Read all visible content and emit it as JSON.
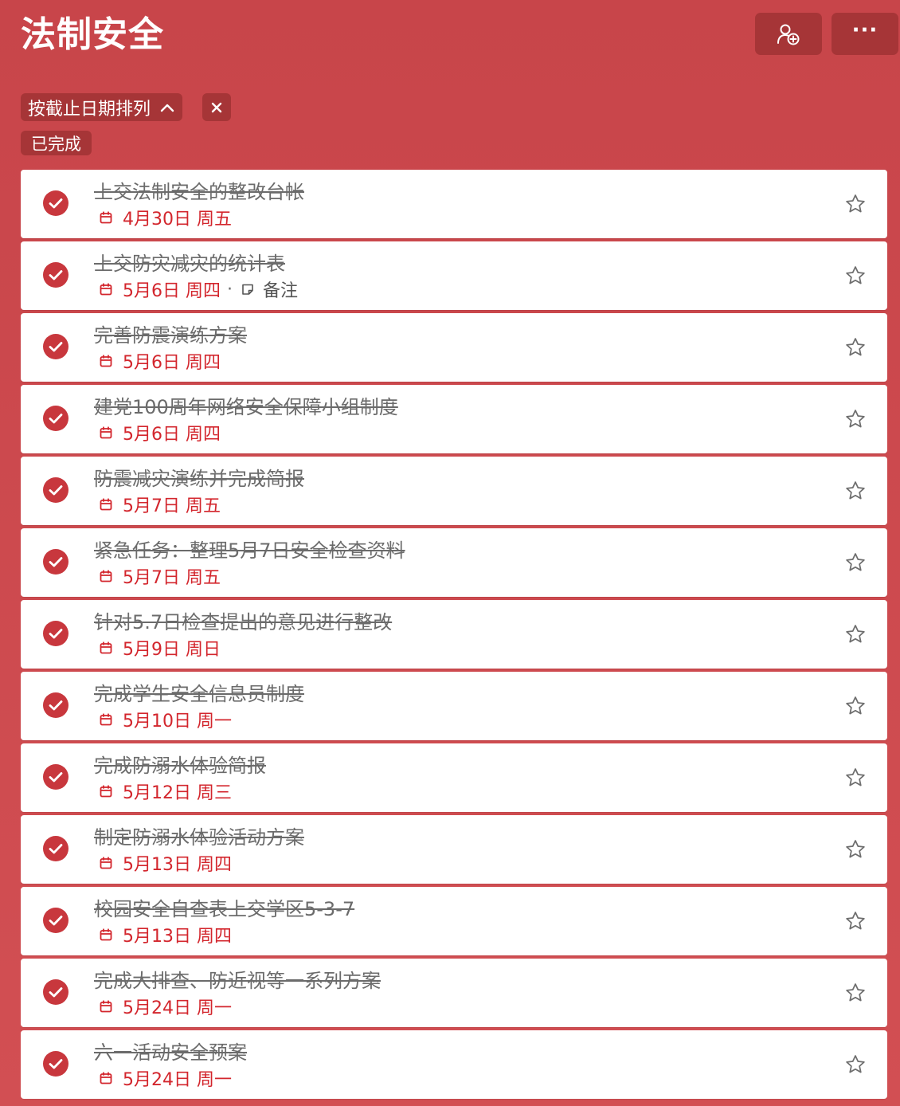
{
  "header": {
    "title": "法制安全",
    "share_icon": "person-add-icon",
    "more_label": "···"
  },
  "filters": {
    "sort_label": "按截止日期排列",
    "sort_icon": "chevron-up-icon",
    "clear_icon": "close-icon",
    "completed_label": "已完成"
  },
  "colors": {
    "accent": "#c8454a",
    "due_red": "#d3262d",
    "chip_dark": "#a63537"
  },
  "tasks": [
    {
      "title": "上交法制安全的整改台帐",
      "due": "4月30日 周五",
      "note": ""
    },
    {
      "title": "上交防灾减灾的统计表",
      "due": "5月6日 周四",
      "note": "备注"
    },
    {
      "title": "完善防震演练方案",
      "due": "5月6日 周四",
      "note": ""
    },
    {
      "title": "建党100周年网络安全保障小组制度",
      "due": "5月6日 周四",
      "note": ""
    },
    {
      "title": "防震减灾演练并完成简报",
      "due": "5月7日 周五",
      "note": ""
    },
    {
      "title": "紧急任务：整理5月7日安全检查资料",
      "due": "5月7日 周五",
      "note": ""
    },
    {
      "title": "针对5.7日检查提出的意见进行整改",
      "due": "5月9日 周日",
      "note": ""
    },
    {
      "title": "完成学生安全信息员制度",
      "due": "5月10日 周一",
      "note": ""
    },
    {
      "title": "完成防溺水体验简报",
      "due": "5月12日 周三",
      "note": ""
    },
    {
      "title": "制定防溺水体验活动方案",
      "due": "5月13日 周四",
      "note": ""
    },
    {
      "title": "校园安全自查表上交学区5-3-7",
      "due": "5月13日 周四",
      "note": ""
    },
    {
      "title": "完成大排查、防近视等一系列方案",
      "due": "5月24日 周一",
      "note": ""
    },
    {
      "title": "六一活动安全预案",
      "due": "5月24日 周一",
      "note": ""
    }
  ]
}
